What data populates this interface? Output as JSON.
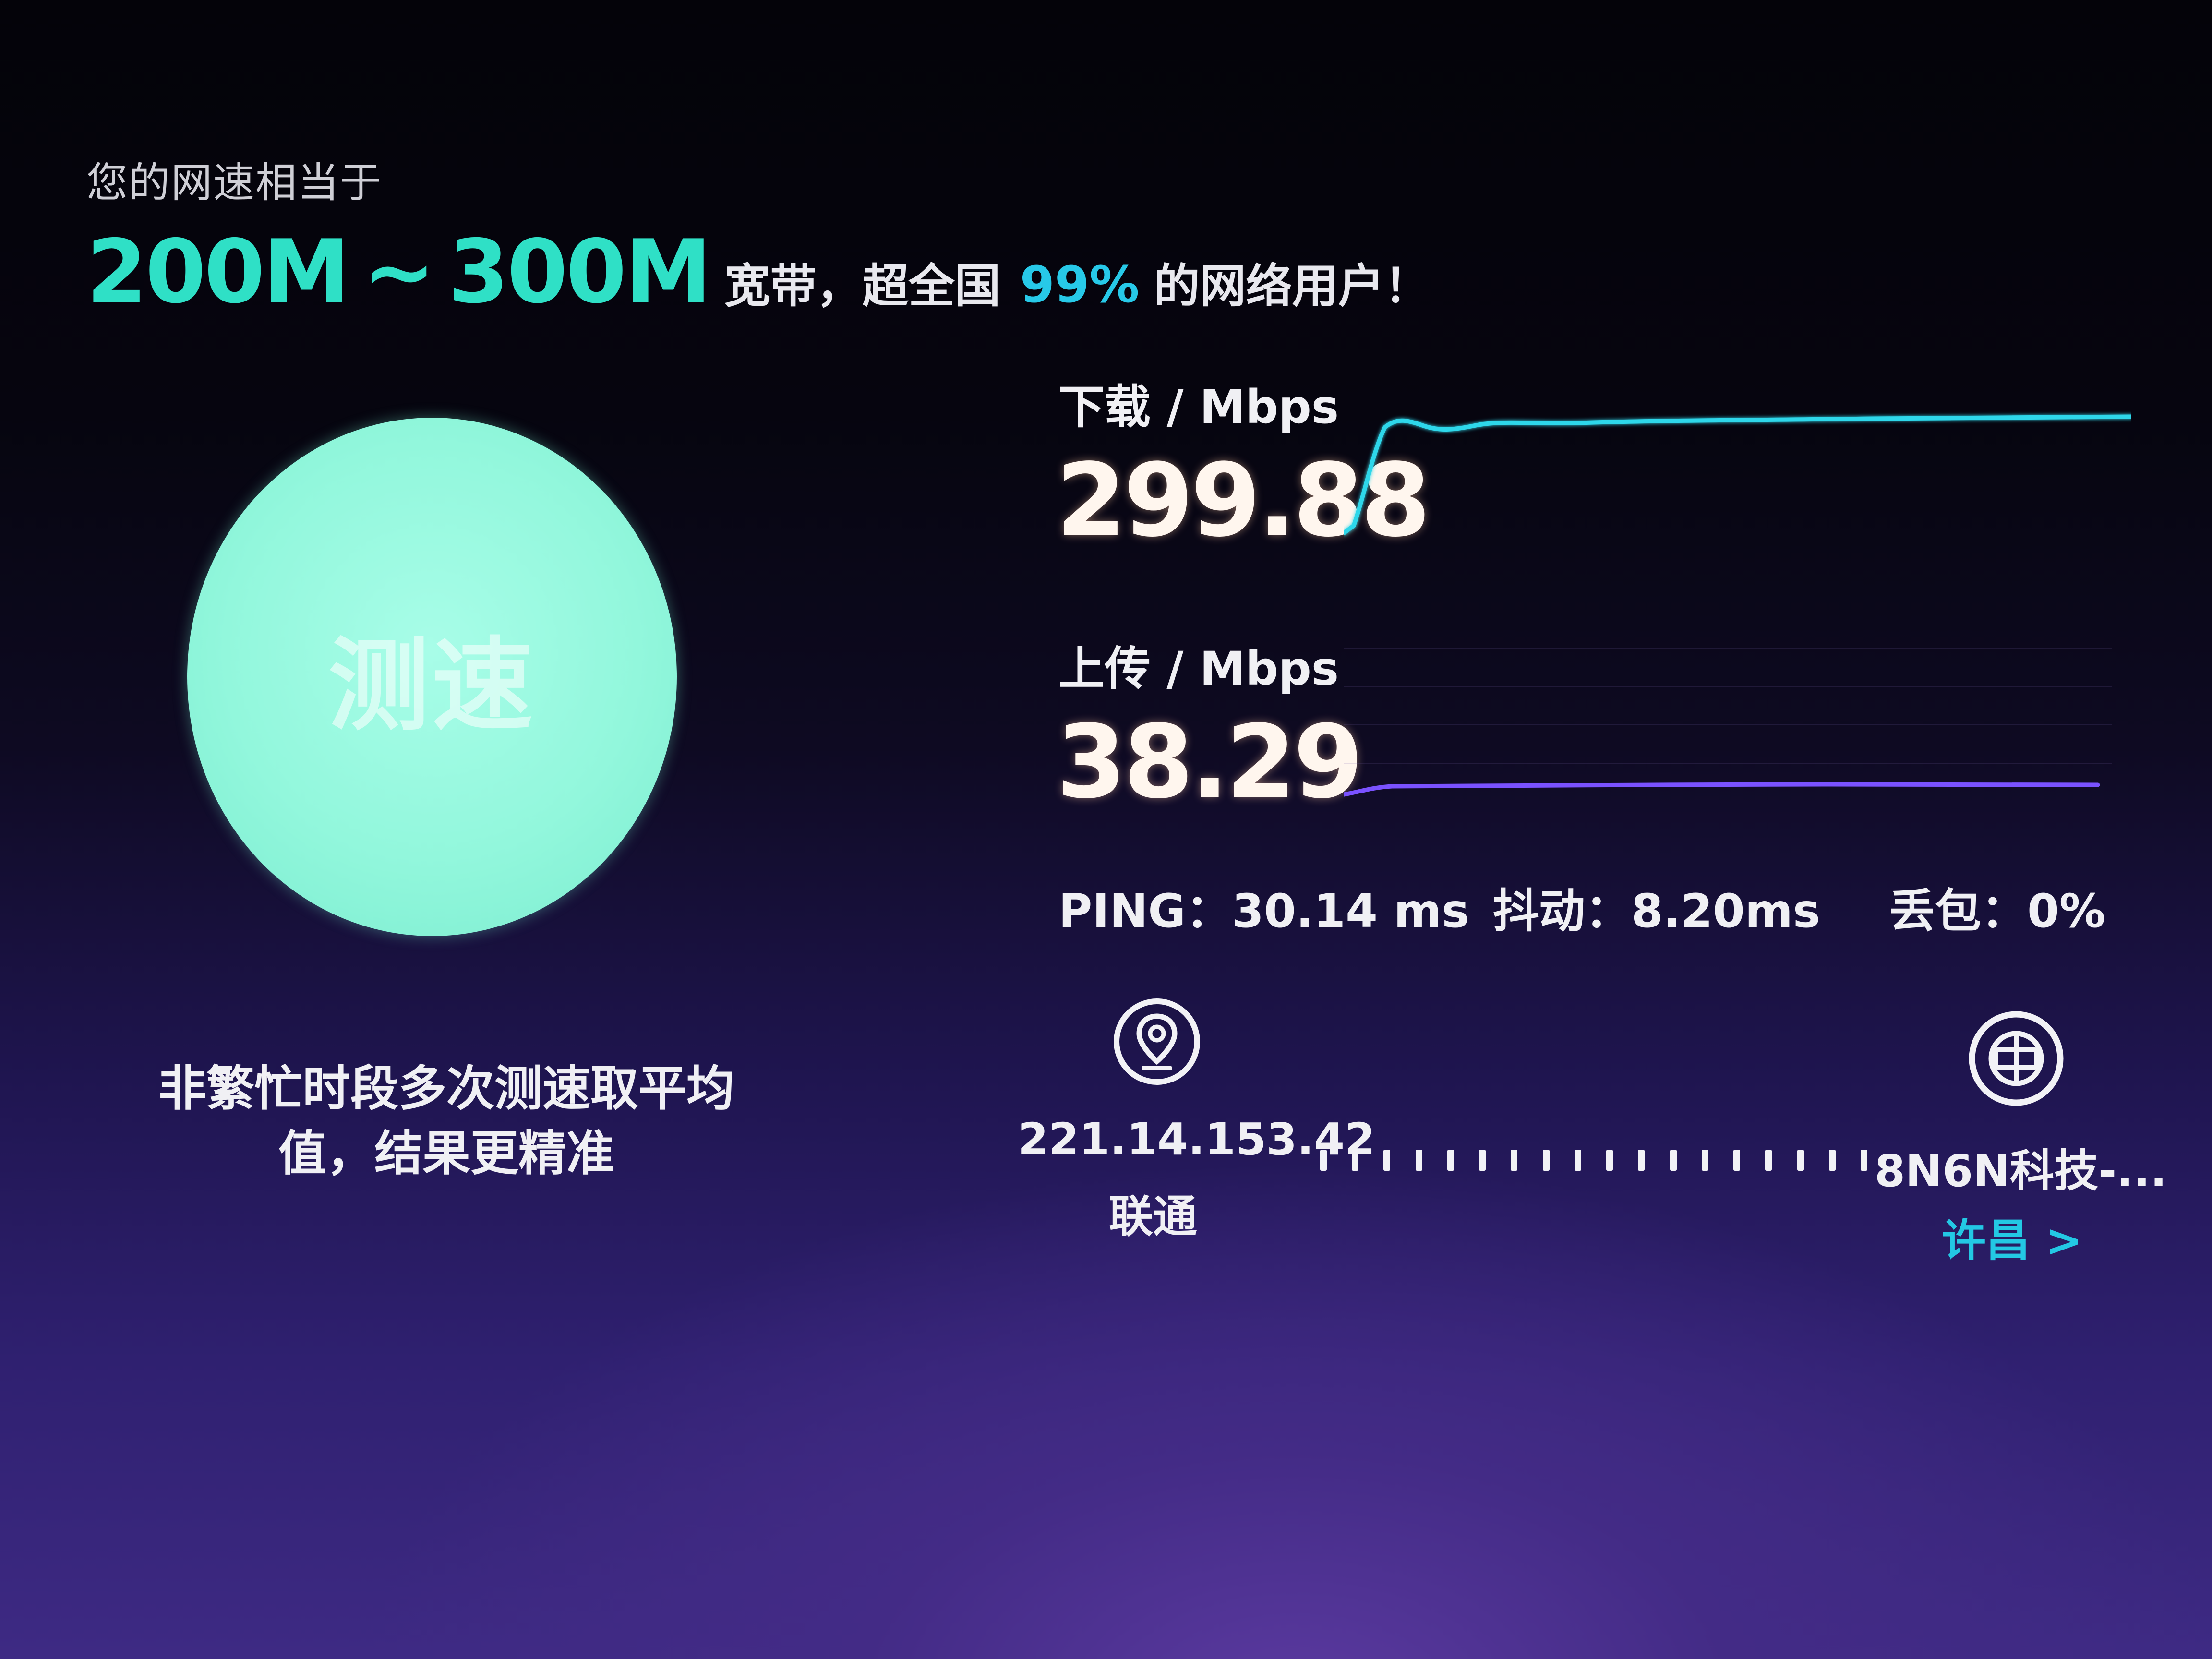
{
  "header": {
    "subtitle": "您的网速相当于",
    "range_low": "200M",
    "range_sep": "~",
    "range_high": "300M",
    "text_before_percent": "宽带，超全国",
    "percent": "99%",
    "text_after_percent": "的网络用户！"
  },
  "start_button": {
    "label": "测速"
  },
  "hint": {
    "line1": "非繁忙时段多次测速取平均",
    "line2": "值，结果更精准"
  },
  "download": {
    "label": "下载 / Mbps",
    "value": "299.88",
    "color": "#2dd7ea"
  },
  "upload": {
    "label": "上传 / Mbps",
    "value": "38.29",
    "color": "#7a52ff"
  },
  "stats": {
    "ping": "PING：30.14 ms",
    "jitter": "抖动：8.20ms",
    "loss": "丢包：0%"
  },
  "connection": {
    "client_ip": "221.14.153.42",
    "client_isp": "联通",
    "server_name": "8N6N科技-...",
    "server_city": "许昌 >",
    "location_icon": "location-pin-icon",
    "server_icon": "server-globe-icon"
  },
  "colors": {
    "accent_green": "#2fe0c6",
    "accent_cyan": "#27c9e8",
    "circle": "#92f7dc"
  }
}
